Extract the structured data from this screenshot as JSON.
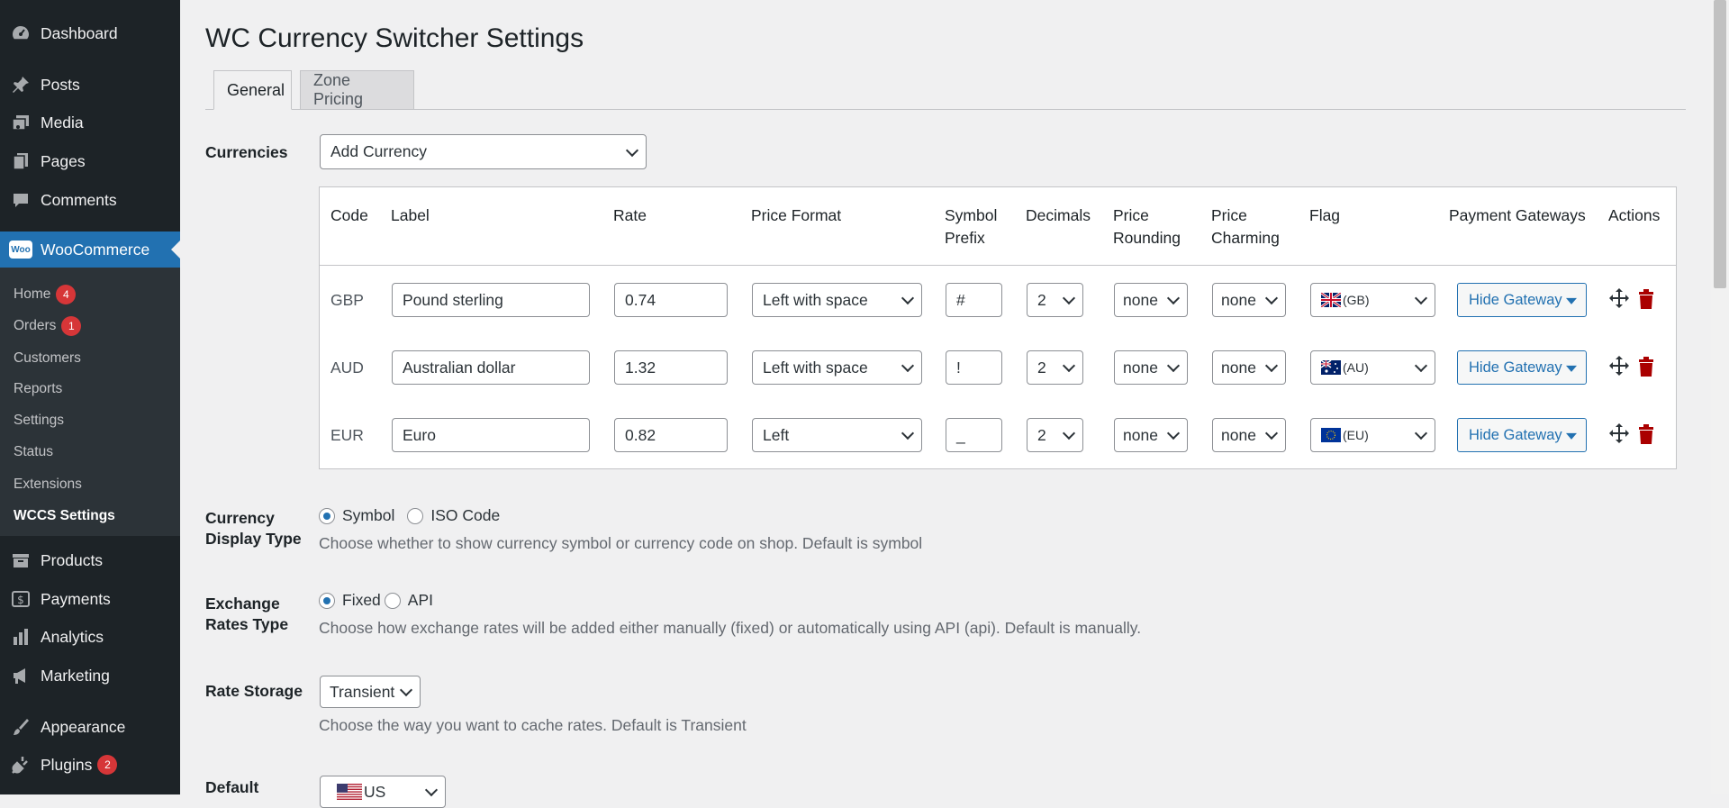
{
  "sidebar": {
    "items": [
      {
        "label": "Dashboard",
        "icon": "dashboard-icon"
      },
      {
        "label": "Posts",
        "icon": "pin-icon"
      },
      {
        "label": "Media",
        "icon": "media-icon"
      },
      {
        "label": "Pages",
        "icon": "pages-icon"
      },
      {
        "label": "Comments",
        "icon": "comments-icon"
      },
      {
        "label": "WooCommerce",
        "icon": "woocommerce-icon"
      },
      {
        "label": "Products",
        "icon": "products-icon"
      },
      {
        "label": "Payments",
        "icon": "payments-icon"
      },
      {
        "label": "Analytics",
        "icon": "analytics-icon"
      },
      {
        "label": "Marketing",
        "icon": "megaphone-icon"
      },
      {
        "label": "Appearance",
        "icon": "paintbrush-icon"
      },
      {
        "label": "Plugins",
        "icon": "plugins-icon",
        "badge": "2"
      }
    ],
    "woo_logo_text": "Woo",
    "submenu": [
      {
        "label": "Home",
        "badge": "4"
      },
      {
        "label": "Orders",
        "badge": "1"
      },
      {
        "label": "Customers"
      },
      {
        "label": "Reports"
      },
      {
        "label": "Settings"
      },
      {
        "label": "Status"
      },
      {
        "label": "Extensions"
      },
      {
        "label": "WCCS Settings"
      }
    ]
  },
  "page": {
    "title": "WC Currency Switcher Settings",
    "tabs": [
      "General",
      "Zone Pricing"
    ]
  },
  "currencies": {
    "label": "Currencies",
    "add_select": "Add Currency",
    "headers": {
      "code": "Code",
      "label": "Label",
      "rate": "Rate",
      "price_format": "Price Format",
      "symbol_prefix_1": "Symbol",
      "symbol_prefix_2": "Prefix",
      "decimals": "Decimals",
      "price_rounding_1": "Price",
      "price_rounding_2": "Rounding",
      "price_charming_1": "Price",
      "price_charming_2": "Charming",
      "flag": "Flag",
      "payment_gateways": "Payment Gateways",
      "actions": "Actions"
    },
    "rows": [
      {
        "code": "GBP",
        "label": "Pound sterling",
        "rate": "0.74",
        "format": "Left with space",
        "prefix": "#",
        "decimals": "2",
        "rounding": "none",
        "charming": "none",
        "flag": "(GB)",
        "gateway": "Hide Gateway"
      },
      {
        "code": "AUD",
        "label": "Australian dollar",
        "rate": "1.32",
        "format": "Left with space",
        "prefix": "!",
        "decimals": "2",
        "rounding": "none",
        "charming": "none",
        "flag": "(AU)",
        "gateway": "Hide Gateway"
      },
      {
        "code": "EUR",
        "label": "Euro",
        "rate": "0.82",
        "format": "Left",
        "prefix": "_",
        "decimals": "2",
        "rounding": "none",
        "charming": "none",
        "flag": "(EU)",
        "gateway": "Hide Gateway"
      }
    ]
  },
  "display_type": {
    "label_1": "Currency",
    "label_2": "Display Type",
    "options": [
      "Symbol",
      "ISO Code"
    ],
    "selected": "Symbol",
    "description": "Choose whether to show currency symbol or currency code on shop. Default is symbol"
  },
  "exchange_type": {
    "label_1": "Exchange",
    "label_2": "Rates Type",
    "options": [
      "Fixed",
      "API"
    ],
    "selected": "Fixed",
    "description": "Choose how exchange rates will be added either manually (fixed) or automatically using API (api). Default is manually."
  },
  "rate_storage": {
    "label": "Rate Storage",
    "value": "Transient",
    "description": "Choose the way you want to cache rates. Default is Transient"
  },
  "default_currency": {
    "label": "Default",
    "value": "US"
  }
}
